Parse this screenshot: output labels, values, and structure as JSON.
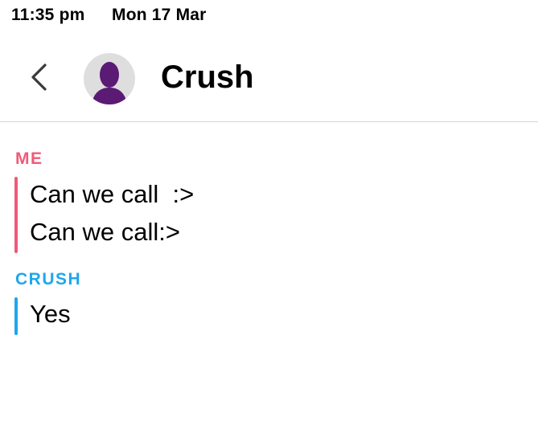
{
  "status_bar": {
    "time": "11:35 pm",
    "date": "Mon 17 Mar"
  },
  "header": {
    "back_icon": "chevron-left-icon",
    "avatar_icon": "person-silhouette-icon",
    "title": "Crush"
  },
  "colors": {
    "me": "#f05a78",
    "crush": "#1ea7ec",
    "avatar_bg": "#dedede",
    "avatar_figure": "#5b1a74"
  },
  "messages": {
    "groups": [
      {
        "sender": "ME",
        "items": [
          "Can we call  :>",
          "Can we call:>"
        ]
      },
      {
        "sender": "CRUSH",
        "items": [
          "Yes"
        ]
      }
    ]
  }
}
